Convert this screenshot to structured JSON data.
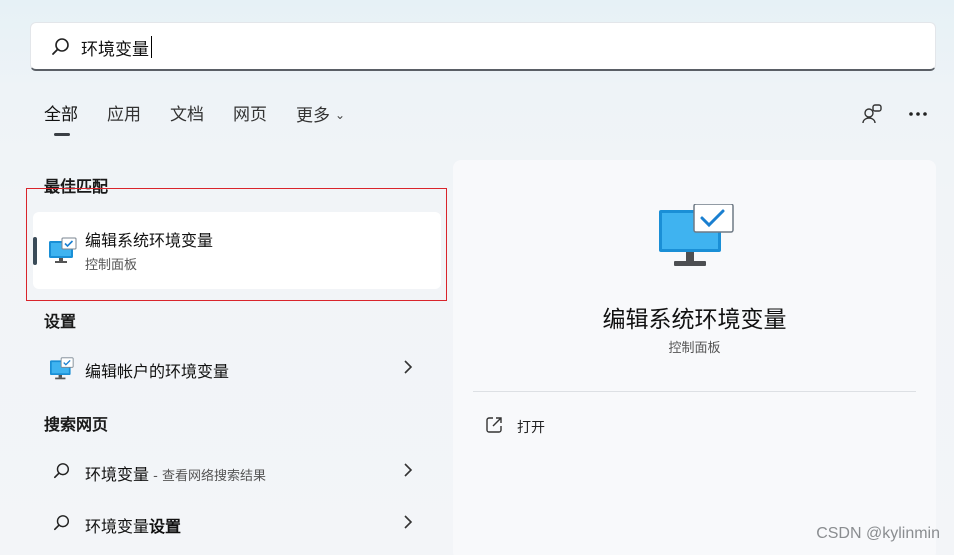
{
  "search": {
    "value": "环境变量",
    "placeholder": ""
  },
  "tabs": [
    {
      "label": "全部",
      "active": true
    },
    {
      "label": "应用"
    },
    {
      "label": "文档"
    },
    {
      "label": "网页"
    },
    {
      "label": "更多"
    }
  ],
  "top_icons": [
    "account-switch-icon",
    "more-options-icon"
  ],
  "best_match": {
    "header": "最佳匹配",
    "title": "编辑系统环境变量",
    "subtitle": "控制面板",
    "icon": "monitor-check-icon"
  },
  "settings": {
    "header": "设置",
    "items": [
      {
        "title": "编辑帐户的环境变量",
        "icon": "monitor-check-icon"
      }
    ]
  },
  "web": {
    "header": "搜索网页",
    "items": [
      {
        "title": "环境变量",
        "suffix": " - 查看网络搜索结果"
      },
      {
        "title_plain": "环境变量",
        "title_bold": "设置"
      }
    ]
  },
  "detail": {
    "title": "编辑系统环境变量",
    "subtitle": "控制面板",
    "actions": [
      {
        "label": "打开",
        "icon": "open-external-icon"
      }
    ]
  },
  "watermark": "CSDN @kylinmin",
  "colors": {
    "highlight_frame": "#d9242b",
    "accent_blue": "#1a8fd6"
  }
}
